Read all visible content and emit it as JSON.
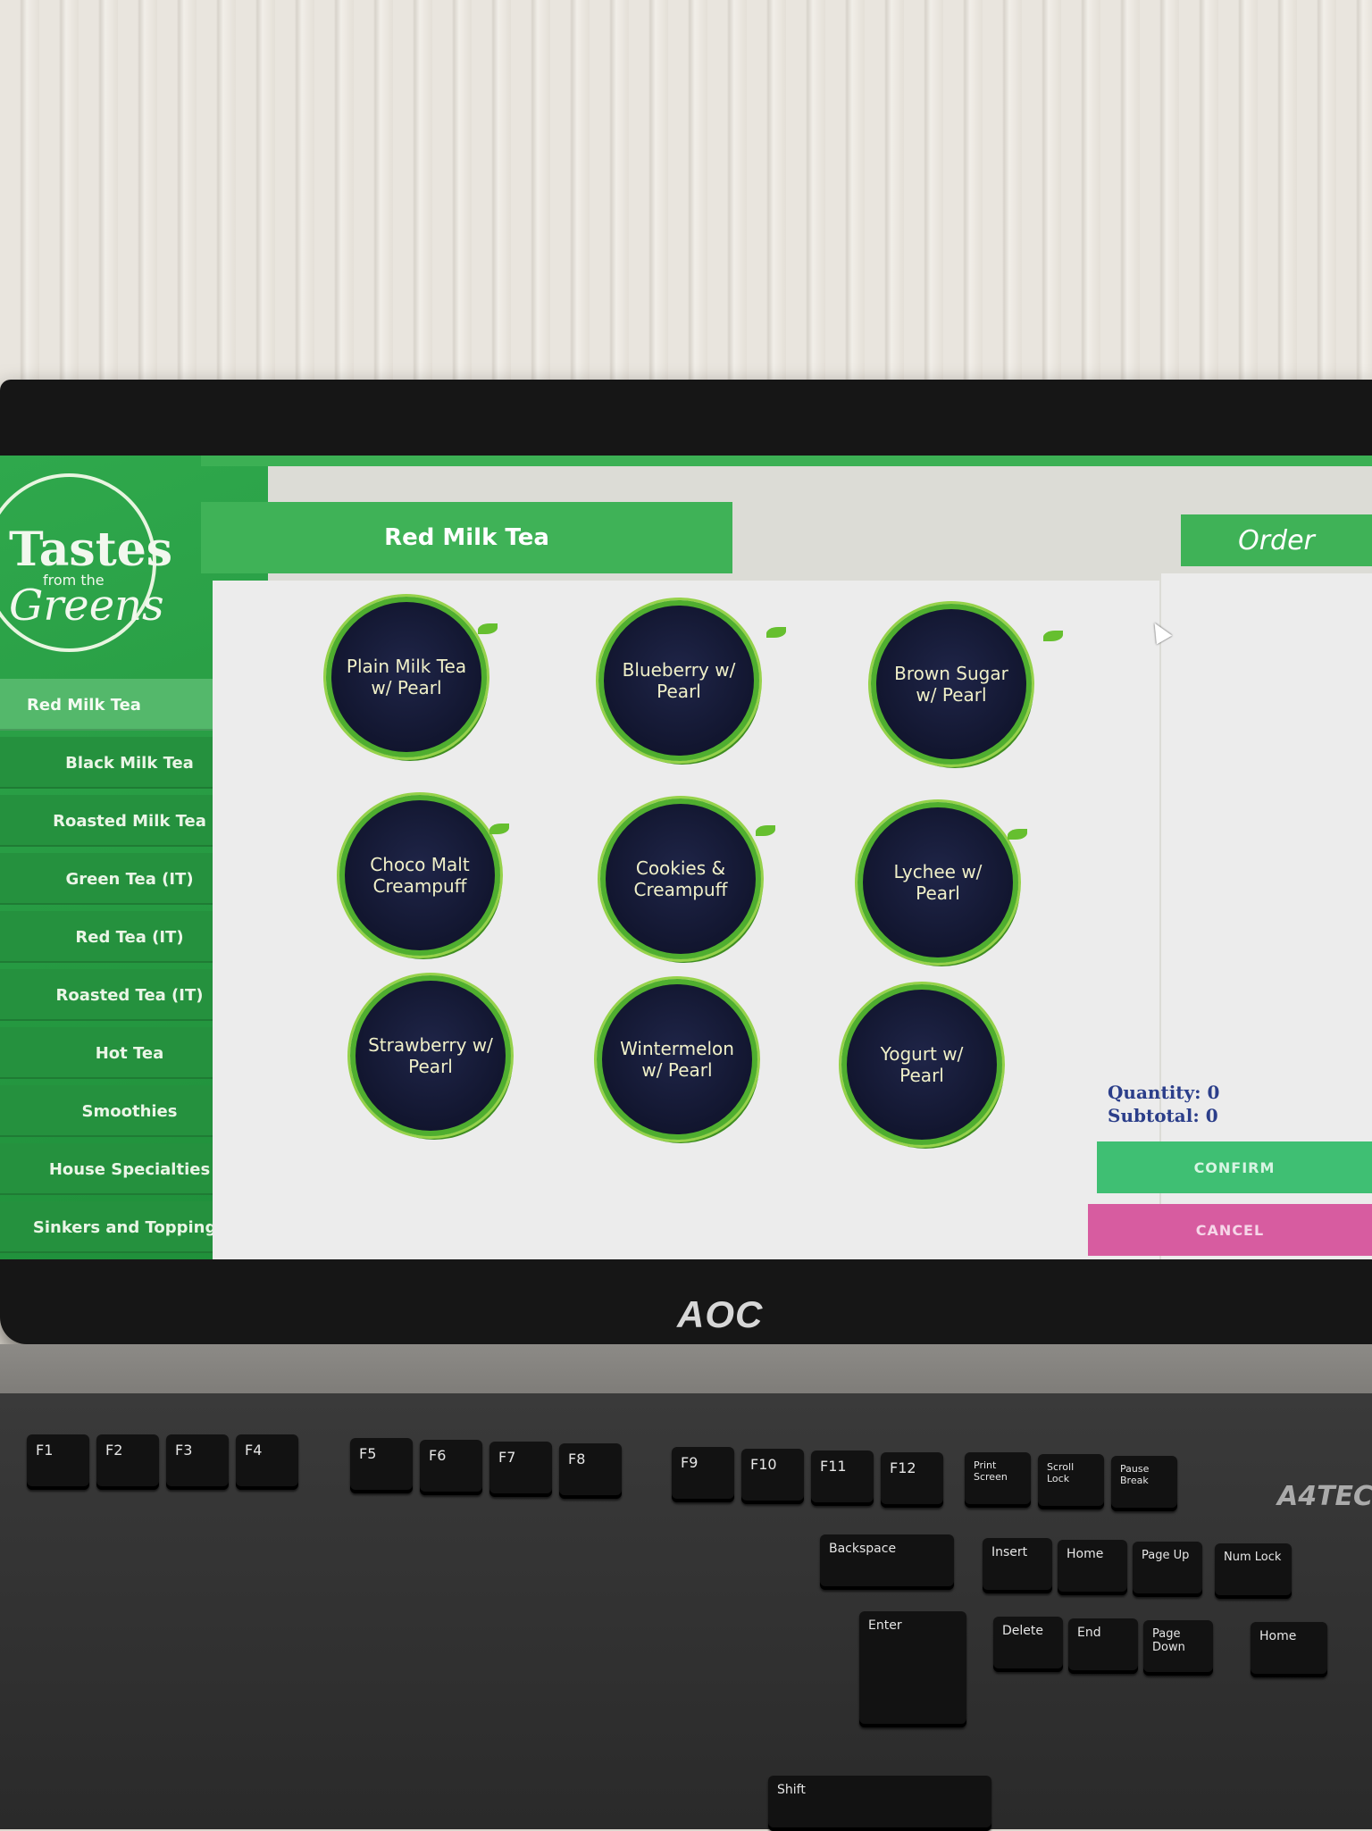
{
  "app": {
    "logo_line1": "Tastes",
    "logo_line2": "from the",
    "logo_line3": "Greens"
  },
  "sidebar": {
    "items": [
      {
        "label": "Red Milk Tea",
        "active": true
      },
      {
        "label": "Black Milk Tea"
      },
      {
        "label": "Roasted Milk Tea"
      },
      {
        "label": "Green Tea (IT)"
      },
      {
        "label": "Red Tea (IT)"
      },
      {
        "label": "Roasted Tea (IT)"
      },
      {
        "label": "Hot Tea"
      },
      {
        "label": "Smoothies"
      },
      {
        "label": "House Specialties"
      },
      {
        "label": "Sinkers and Toppings"
      }
    ]
  },
  "main": {
    "category_title": "Red Milk Tea",
    "products": [
      {
        "name": "Plain Milk Tea w/ Pearl"
      },
      {
        "name": "Blueberry w/ Pearl"
      },
      {
        "name": "Brown Sugar w/ Pearl"
      },
      {
        "name": "Choco Malt Creampuff"
      },
      {
        "name": "Cookies & Creampuff"
      },
      {
        "name": "Lychee w/ Pearl"
      },
      {
        "name": "Strawberry w/ Pearl"
      },
      {
        "name": "Wintermelon w/ Pearl"
      },
      {
        "name": "Yogurt w/ Pearl"
      }
    ]
  },
  "order": {
    "title": "Order",
    "quantity_label": "Quantity: 0",
    "subtotal_label": "Subtotal: 0",
    "confirm_label": "CONFIRM",
    "cancel_label": "CANCEL"
  },
  "hardware": {
    "monitor_brand": "AOC",
    "keyboard_brand": "A4TEC"
  },
  "keyboard": {
    "keys": [
      "F1",
      "F2",
      "F3",
      "F4",
      "F5",
      "F6",
      "F7",
      "F8",
      "F9",
      "F10",
      "F11",
      "F12",
      "Print Screen",
      "Scroll Lock",
      "Pause Break",
      "Backspace",
      "Insert",
      "Home",
      "Page Up",
      "Num Lock",
      "Enter",
      "Delete",
      "End",
      "Page Down",
      "Home",
      "Shift"
    ]
  },
  "colors": {
    "brand_green": "#3fb257",
    "confirm": "#3fbf73",
    "cancel": "#d75ca0",
    "product_circle": "#141a3a"
  }
}
